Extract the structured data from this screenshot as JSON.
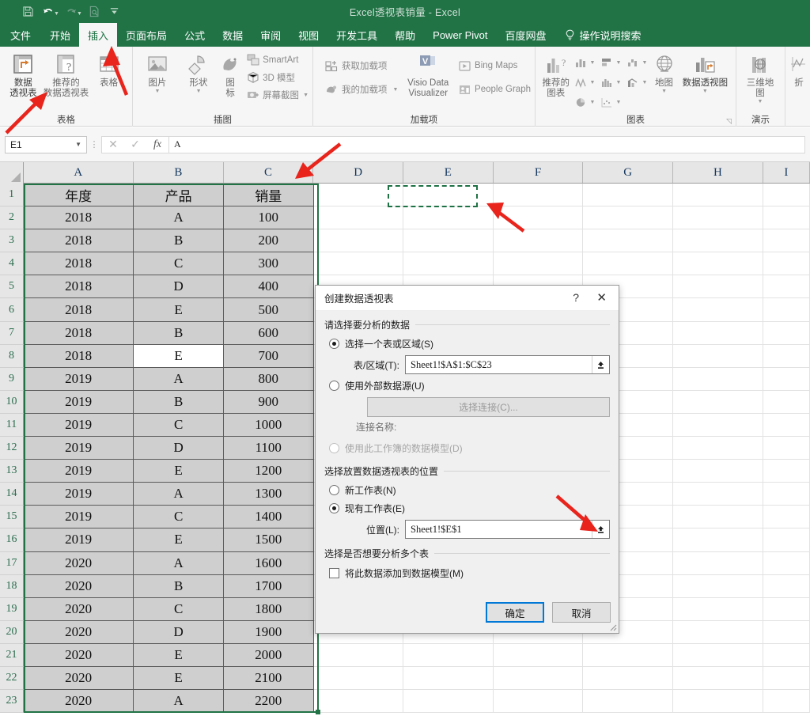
{
  "window": {
    "title": "Excel透视表销量  -  Excel"
  },
  "qat": {
    "items": [
      {
        "name": "save-icon",
        "label": "保存"
      },
      {
        "name": "undo-icon",
        "label": "撤消"
      },
      {
        "name": "redo-icon",
        "label": "恢复"
      },
      {
        "name": "print-preview-icon",
        "label": "打印预览和打印"
      },
      {
        "name": "customize-qat-icon",
        "label": "自定义快速访问工具栏"
      }
    ]
  },
  "tabs": [
    {
      "label": "文件",
      "active": false
    },
    {
      "label": "开始",
      "active": false
    },
    {
      "label": "插入",
      "active": true
    },
    {
      "label": "页面布局",
      "active": false
    },
    {
      "label": "公式",
      "active": false
    },
    {
      "label": "数据",
      "active": false
    },
    {
      "label": "审阅",
      "active": false
    },
    {
      "label": "视图",
      "active": false
    },
    {
      "label": "开发工具",
      "active": false
    },
    {
      "label": "帮助",
      "active": false
    },
    {
      "label": "Power Pivot",
      "active": false
    },
    {
      "label": "百度网盘",
      "active": false
    }
  ],
  "search": {
    "label": "操作说明搜索"
  },
  "ribbon": {
    "groups": [
      {
        "label": "表格",
        "buttons": [
          {
            "line1": "数据",
            "line2": "透视表"
          },
          {
            "line1": "推荐的",
            "line2": "数据透视表"
          },
          {
            "line1": "表格",
            "line2": ""
          }
        ]
      },
      {
        "label": "插图",
        "buttons": [
          {
            "line1": "图片",
            "line2": ""
          },
          {
            "line1": "形状",
            "line2": ""
          },
          {
            "line1": "图",
            "line2": "标"
          }
        ],
        "small": [
          {
            "label": "SmartArt",
            "icon": "smartart-icon"
          },
          {
            "label": "3D 模型",
            "icon": "cube-icon"
          },
          {
            "label": "屏幕截图",
            "icon": "screenshot-icon"
          }
        ]
      },
      {
        "label": "加载项",
        "small": [
          {
            "label": "获取加载项",
            "icon": "get-addins-icon"
          },
          {
            "label": "我的加载项",
            "icon": "my-addins-icon"
          }
        ],
        "buttons": [
          {
            "line1": "Visio Data",
            "line2": "Visualizer"
          }
        ],
        "small2": [
          {
            "label": "Bing Maps",
            "icon": "bing-maps-icon"
          },
          {
            "label": "People Graph",
            "icon": "people-graph-icon"
          }
        ]
      },
      {
        "label": "图表",
        "buttons": [
          {
            "line1": "推荐的",
            "line2": "图表"
          },
          {
            "line1": "地图",
            "line2": ""
          },
          {
            "line1": "数据透视图",
            "line2": ""
          }
        ]
      },
      {
        "label": "演示",
        "buttons": [
          {
            "line1": "三维地",
            "line2": "图"
          }
        ]
      },
      {
        "label": "",
        "buttons": [
          {
            "line1": "折",
            "line2": ""
          }
        ]
      }
    ]
  },
  "formula_bar": {
    "name_box": "E1",
    "cancel_icon": "cancel-icon",
    "confirm_icon": "confirm-icon",
    "fx_label": "fx",
    "value": "A"
  },
  "grid": {
    "columns": [
      "A",
      "B",
      "C",
      "D",
      "E",
      "F",
      "G",
      "H",
      "I"
    ],
    "row_numbers": [
      1,
      2,
      3,
      4,
      5,
      6,
      7,
      8,
      9,
      10,
      11,
      12,
      13,
      14,
      15,
      16,
      17,
      18,
      19,
      20,
      21,
      22,
      23
    ],
    "headers": [
      "年度",
      "产品",
      "销量"
    ],
    "rows": [
      [
        "2018",
        "A",
        "100"
      ],
      [
        "2018",
        "B",
        "200"
      ],
      [
        "2018",
        "C",
        "300"
      ],
      [
        "2018",
        "D",
        "400"
      ],
      [
        "2018",
        "E",
        "500"
      ],
      [
        "2018",
        "B",
        "600"
      ],
      [
        "2018",
        "E",
        "700"
      ],
      [
        "2019",
        "A",
        "800"
      ],
      [
        "2019",
        "B",
        "900"
      ],
      [
        "2019",
        "C",
        "1000"
      ],
      [
        "2019",
        "D",
        "1100"
      ],
      [
        "2019",
        "E",
        "1200"
      ],
      [
        "2019",
        "A",
        "1300"
      ],
      [
        "2019",
        "C",
        "1400"
      ],
      [
        "2019",
        "E",
        "1500"
      ],
      [
        "2020",
        "A",
        "1600"
      ],
      [
        "2020",
        "B",
        "1700"
      ],
      [
        "2020",
        "C",
        "1800"
      ],
      [
        "2020",
        "D",
        "1900"
      ],
      [
        "2020",
        "E",
        "2000"
      ],
      [
        "2020",
        "E",
        "2100"
      ],
      [
        "2020",
        "A",
        "2200"
      ]
    ],
    "active_cell": "B9",
    "marching_ants_cell": "E1"
  },
  "dialog": {
    "title": "创建数据透视表",
    "help_icon": "?",
    "close_icon": "✕",
    "section1_label": "请选择要分析的数据",
    "radio_table_range": "选择一个表或区域(S)",
    "field_table_range_label": "表/区域(T):",
    "field_table_range_value": "Sheet1!$A$1:$C$23",
    "radio_external": "使用外部数据源(U)",
    "btn_choose_connection": "选择连接(C)...",
    "connection_name_label": "连接名称:",
    "radio_data_model": "使用此工作簿的数据模型(D)",
    "section2_label": "选择放置数据透视表的位置",
    "radio_new_sheet": "新工作表(N)",
    "radio_existing_sheet": "现有工作表(E)",
    "field_location_label": "位置(L):",
    "field_location_value": "Sheet1!$E$1",
    "section3_label": "选择是否想要分析多个表",
    "checkbox_add_to_model": "将此数据添加到数据模型(M)",
    "btn_ok": "确定",
    "btn_cancel": "取消"
  },
  "colors": {
    "excel_green": "#217346",
    "ribbon_bg": "#f6f6f6",
    "selection_green": "#217346",
    "annotation_red": "#e8241c",
    "data_fill": "#cfcfcf",
    "accent_blue": "#0078d7"
  },
  "annotations": [
    {
      "name": "arrow-to-insert-tab"
    },
    {
      "name": "arrow-to-pivot-table-button"
    },
    {
      "name": "arrow-to-column-c"
    },
    {
      "name": "arrow-to-cell-e1"
    },
    {
      "name": "arrow-to-location-collapse-button"
    }
  ]
}
